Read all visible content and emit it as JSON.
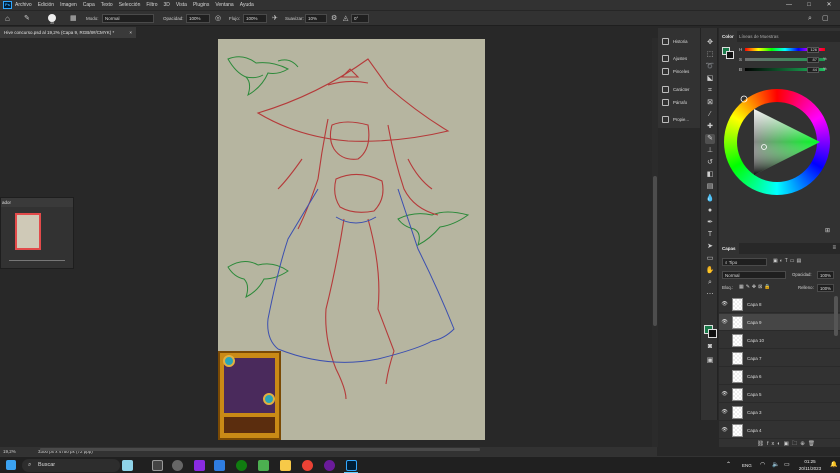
{
  "app": {
    "logo": "Ps"
  },
  "menu": [
    "Archivo",
    "Edición",
    "Imagen",
    "Capa",
    "Texto",
    "Selección",
    "Filtro",
    "3D",
    "Vista",
    "Plugins",
    "Ventana",
    "Ayuda"
  ],
  "window_controls": {
    "minimize": "—",
    "maximize": "□",
    "close": "✕"
  },
  "options": {
    "brush_size": "35",
    "mode_label": "Modo:",
    "mode_value": "Normal",
    "opacity_label": "Opacidad:",
    "opacity_value": "100%",
    "flow_label": "Flujo:",
    "flow_value": "100%",
    "smooth_label": "Suavizar:",
    "smooth_value": "10%",
    "angle_value": "0°"
  },
  "document_tab": {
    "title": "Hive concurso.psd al 19,2% (Capa 9, RGB/8#/CMYK) *",
    "close": "×"
  },
  "navigator": {
    "title": "ador"
  },
  "status": {
    "zoom": "19,2%",
    "doc_info": "3300 px x 4750 px (72 ppp)"
  },
  "dock": [
    {
      "label": "Historia",
      "icon": "history-icon"
    },
    {
      "label": "Ajustes",
      "icon": "adjustments-icon"
    },
    {
      "label": "Pinceles",
      "icon": "brushes-icon"
    },
    {
      "label": "Carácter",
      "icon": "character-icon"
    },
    {
      "label": "Párrafo",
      "icon": "paragraph-icon"
    },
    {
      "label": "Propie...",
      "icon": "properties-icon"
    }
  ],
  "color_panel": {
    "tabs": [
      "Color",
      "Líneas de Muestras"
    ],
    "h_label": "H",
    "h_value": "126",
    "s_label": "S",
    "s_value": "87",
    "b_label": "B",
    "b_value": "44",
    "unit": "%",
    "foreground": "#1a7a4a",
    "background": "#111111"
  },
  "layers_panel": {
    "tab": "Capas",
    "filter_label": "Tipo",
    "blend_mode": "Normal",
    "opacity_label": "Opacidad:",
    "opacity_value": "100%",
    "lock_label": "Bloq.:",
    "fill_label": "Relleno:",
    "fill_value": "100%",
    "layers": [
      {
        "name": "Capa 8",
        "visible": true,
        "selected": false
      },
      {
        "name": "Capa 9",
        "visible": true,
        "selected": true
      },
      {
        "name": "Capa 10",
        "visible": false,
        "selected": false
      },
      {
        "name": "Capa 7",
        "visible": false,
        "selected": false
      },
      {
        "name": "Capa 6",
        "visible": false,
        "selected": false
      },
      {
        "name": "Capa 5",
        "visible": true,
        "selected": false
      },
      {
        "name": "Capa 3",
        "visible": true,
        "selected": false
      },
      {
        "name": "Capa 4",
        "visible": true,
        "selected": false
      }
    ]
  },
  "taskbar": {
    "search_placeholder": "Buscar",
    "language": "ENG",
    "time": "01:25",
    "date": "20/11/2023"
  }
}
